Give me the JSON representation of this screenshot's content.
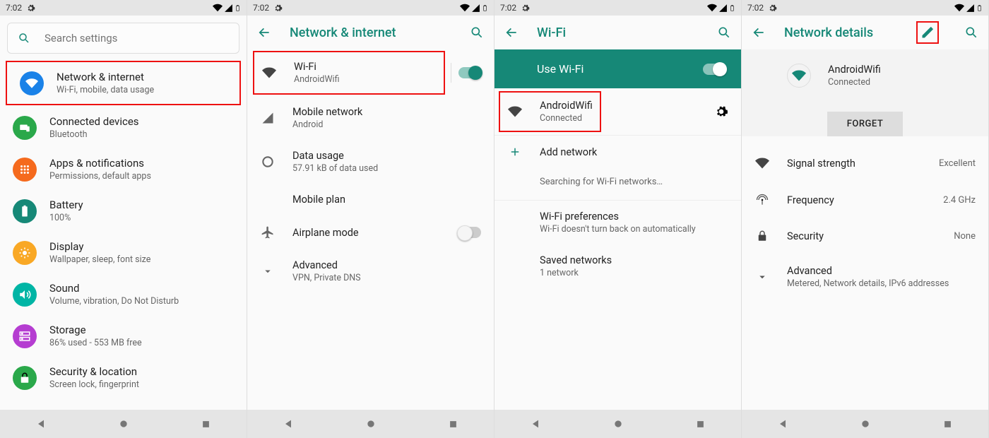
{
  "statusbar": {
    "time": "7:02"
  },
  "panel1": {
    "search_placeholder": "Search settings",
    "items": [
      {
        "title": "Network & internet",
        "subtitle": "Wi-Fi, mobile, data usage"
      },
      {
        "title": "Connected devices",
        "subtitle": "Bluetooth"
      },
      {
        "title": "Apps & notifications",
        "subtitle": "Permissions, default apps"
      },
      {
        "title": "Battery",
        "subtitle": "100%"
      },
      {
        "title": "Display",
        "subtitle": "Wallpaper, sleep, font size"
      },
      {
        "title": "Sound",
        "subtitle": "Volume, vibration, Do Not Disturb"
      },
      {
        "title": "Storage",
        "subtitle": "86% used - 553 MB free"
      },
      {
        "title": "Security & location",
        "subtitle": "Screen lock, fingerprint"
      }
    ]
  },
  "panel2": {
    "header": "Network & internet",
    "rows": {
      "wifi": {
        "title": "Wi-Fi",
        "subtitle": "AndroidWifi"
      },
      "mobile": {
        "title": "Mobile network",
        "subtitle": "Android"
      },
      "data": {
        "title": "Data usage",
        "subtitle": "57.91 kB of data used"
      },
      "plan": {
        "title": "Mobile plan"
      },
      "airplane": {
        "title": "Airplane mode"
      },
      "advanced": {
        "title": "Advanced",
        "subtitle": "VPN, Private DNS"
      }
    }
  },
  "panel3": {
    "header": "Wi-Fi",
    "use_wifi": "Use Wi-Fi",
    "connected": {
      "title": "AndroidWifi",
      "subtitle": "Connected"
    },
    "add": "Add network",
    "searching": "Searching for Wi-Fi networks…",
    "prefs": {
      "title": "Wi-Fi preferences",
      "subtitle": "Wi-Fi doesn't turn back on automatically"
    },
    "saved": {
      "title": "Saved networks",
      "subtitle": "1 network"
    }
  },
  "panel4": {
    "header": "Network details",
    "ssid": "AndroidWifi",
    "status": "Connected",
    "forget": "FORGET",
    "rows": {
      "signal": {
        "label": "Signal strength",
        "value": "Excellent"
      },
      "freq": {
        "label": "Frequency",
        "value": "2.4 GHz"
      },
      "security": {
        "label": "Security",
        "value": "None"
      },
      "advanced": {
        "label": "Advanced",
        "sub": "Metered, Network details, IPv6 addresses"
      }
    }
  }
}
